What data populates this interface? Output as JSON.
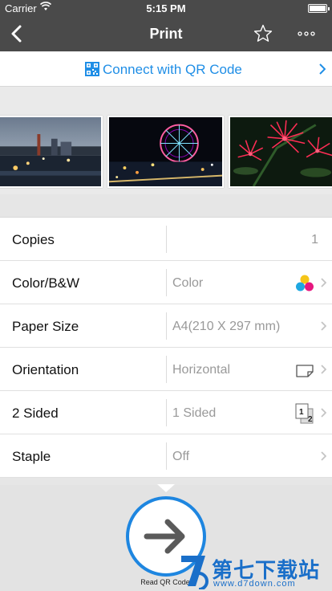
{
  "status": {
    "carrier": "Carrier",
    "time": "5:15 PM"
  },
  "nav": {
    "title": "Print",
    "back_icon": "chevron-left-icon",
    "favorite_icon": "star-icon",
    "more_icon": "more-icon"
  },
  "qr": {
    "label": "Connect with QR Code",
    "color": "#1f8ee6"
  },
  "gallery": {
    "images": [
      "harbor-night-photo",
      "ferris-wheel-night-photo",
      "red-flowers-photo"
    ]
  },
  "settings": {
    "copies": {
      "label": "Copies",
      "value": "1"
    },
    "color": {
      "label": "Color/B&W",
      "value": "Color",
      "icon": "color-dots-icon"
    },
    "paper": {
      "label": "Paper Size",
      "value": "A4(210 X 297 mm)"
    },
    "orientation": {
      "label": "Orientation",
      "value": "Horizontal",
      "icon": "landscape-page-icon"
    },
    "sided": {
      "label": "2 Sided",
      "value": "1 Sided",
      "icon": "duplex-icon",
      "icon_front": "1",
      "icon_back": "2"
    },
    "staple": {
      "label": "Staple",
      "value": "Off"
    }
  },
  "read_qr": {
    "label": "Read QR Code",
    "icon": "arrow-right-icon",
    "ring_color": "#1e86e0"
  },
  "watermark": {
    "brand": "第七下载站",
    "url": "www.d7down.com"
  }
}
